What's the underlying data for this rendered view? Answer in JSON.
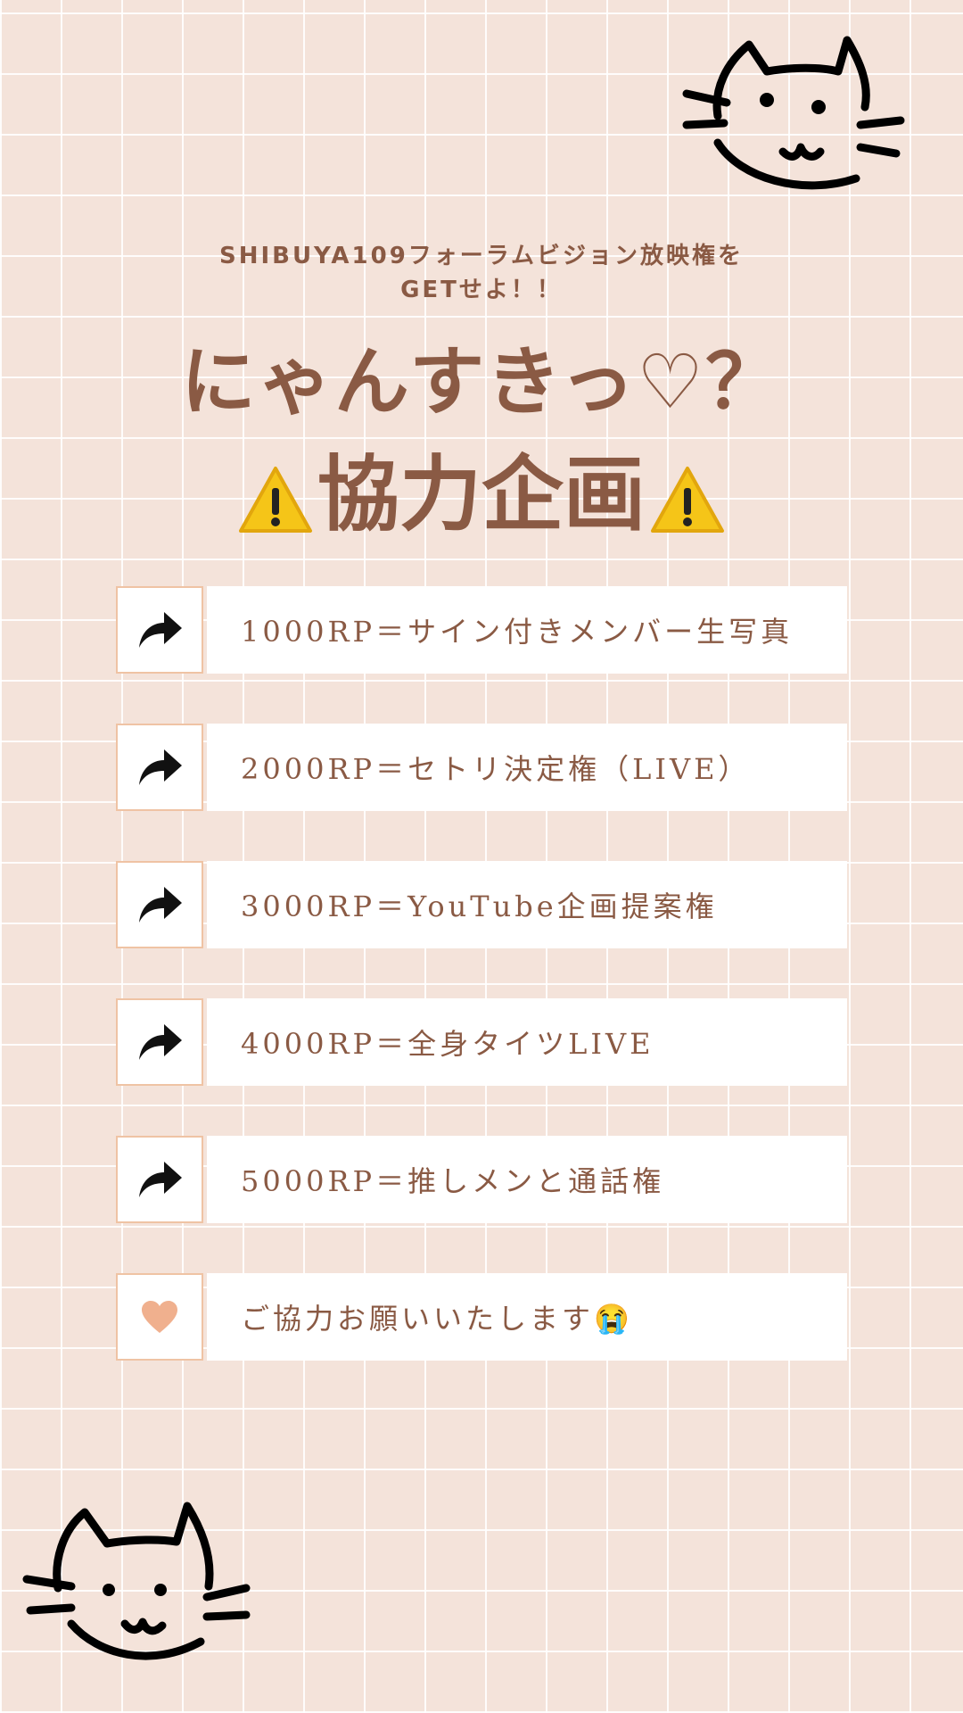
{
  "header": {
    "subtitle_line1": "SHIBUYA109フォーラムビジョン放映権を",
    "subtitle_line2": "GETせよ！！",
    "title": "にゃんすきっ♡？",
    "campaign": "協力企画"
  },
  "items": [
    {
      "icon": "share-arrow-icon",
      "text": "1000RP＝サイン付きメンバー生写真"
    },
    {
      "icon": "share-arrow-icon",
      "text": "2000RP＝セトリ決定権（LIVE）"
    },
    {
      "icon": "share-arrow-icon",
      "text": "3000RP＝YouTube企画提案権"
    },
    {
      "icon": "share-arrow-icon",
      "text": "4000RP＝全身タイツLIVE"
    },
    {
      "icon": "share-arrow-icon",
      "text": "5000RP＝推しメンと通話権"
    },
    {
      "icon": "heart-icon",
      "text": "ご協力お願いいたします😭"
    }
  ],
  "colors": {
    "background": "#f4e3da",
    "text_brown": "#8a5a44",
    "box_border": "#efc3a4",
    "heart": "#f0b08e",
    "warning": "#f5c518"
  }
}
